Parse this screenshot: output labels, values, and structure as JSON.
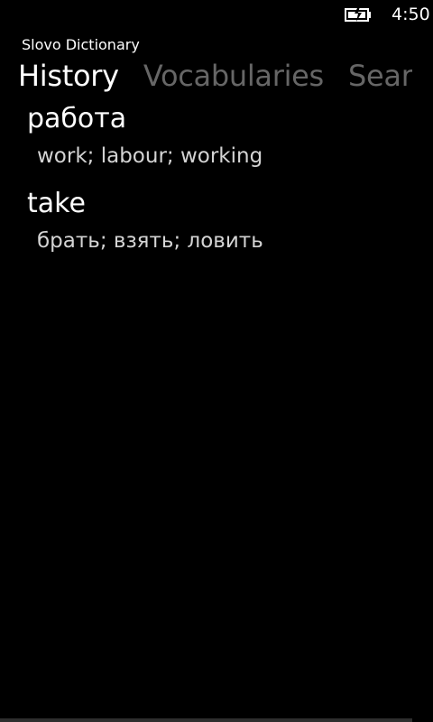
{
  "status_bar": {
    "battery_icon": "battery-charging-icon",
    "time": "4:50"
  },
  "app": {
    "title": "Slovo Dictionary"
  },
  "pivot": {
    "tabs": [
      {
        "label": "History",
        "active": true
      },
      {
        "label": "Vocabularies",
        "active": false
      },
      {
        "label": "Search",
        "active": false
      }
    ]
  },
  "history": {
    "items": [
      {
        "word": "работа",
        "translation": "work; labour; working"
      },
      {
        "word": "take",
        "translation": "брать; взять; ловить"
      }
    ]
  },
  "colors": {
    "background": "#000000",
    "active_text": "#ffffff",
    "inactive_tab": "#666666",
    "translation_text": "#d4d4d4"
  }
}
